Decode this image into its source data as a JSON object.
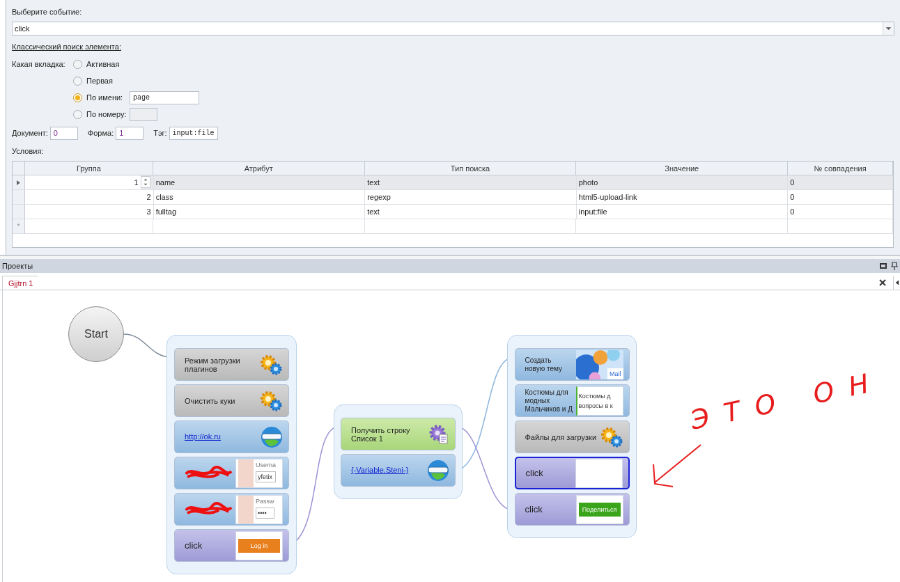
{
  "event": {
    "label": "Выберите событие:",
    "value": "click"
  },
  "search_heading": "Классический поиск элемента:",
  "tab_choice": {
    "label": "Какая вкладка:",
    "options": [
      {
        "label": "Активная",
        "selected": false,
        "kind": "plain"
      },
      {
        "label": "Первая",
        "selected": false,
        "kind": "plain"
      },
      {
        "label": "По имени:",
        "selected": true,
        "kind": "text",
        "value": "page"
      },
      {
        "label": "По номеру:",
        "selected": false,
        "kind": "disabled"
      }
    ]
  },
  "fields": [
    {
      "label": "Документ:",
      "value": "0",
      "kind": "short"
    },
    {
      "label": "Форма:",
      "value": "1",
      "kind": "short"
    },
    {
      "label": "Тэг:",
      "value": "input:file",
      "kind": "mono"
    }
  ],
  "conditions": {
    "label": "Условия:",
    "columns": [
      "Группа",
      "Атрибут",
      "Тип поиска",
      "Значение",
      "№ совпадения"
    ],
    "rows": [
      {
        "cells": [
          "1",
          "name",
          "text",
          "photo",
          "0"
        ],
        "selected": true
      },
      {
        "cells": [
          "2",
          "class",
          "regexp",
          "html5-upload-link",
          "0"
        ],
        "selected": false
      },
      {
        "cells": [
          "3",
          "fulltag",
          "text",
          "input:file",
          "0"
        ],
        "selected": false
      }
    ],
    "new_row_marker": "*"
  },
  "projects": {
    "title": "Проекты",
    "tab": "Gjjtrn 1"
  },
  "diagram": {
    "start": "Start",
    "groups": [
      {
        "nodes": [
          {
            "kind": "gear",
            "label": "Режим загрузки плагинов",
            "selected": false,
            "redacted": false
          },
          {
            "kind": "gear",
            "label": "Очистить куки",
            "selected": false,
            "redacted": false
          },
          {
            "kind": "navigate",
            "label": "http://ok.ru",
            "selected": false,
            "redacted": false
          },
          {
            "kind": "input",
            "selected": false,
            "redacted": true,
            "thumb": {
              "kind": "field",
              "label": "Userna",
              "value": "yfetix"
            }
          },
          {
            "kind": "input",
            "selected": false,
            "redacted": true,
            "thumb": {
              "kind": "field",
              "label": "Passw",
              "value": "••••"
            }
          },
          {
            "kind": "click",
            "label": "click",
            "selected": false,
            "redacted": false,
            "thumb": {
              "kind": "button",
              "text": "Log in",
              "color": "#e8801e"
            }
          }
        ]
      },
      {
        "nodes": [
          {
            "kind": "list",
            "label": "Получить строку Список 1",
            "selected": false,
            "redacted": false
          },
          {
            "kind": "navigate",
            "label": "{-Variable.Steni-}",
            "selected": false,
            "redacted": false
          }
        ]
      },
      {
        "nodes": [
          {
            "kind": "input",
            "label": "Создать новую тему",
            "selected": false,
            "redacted": false,
            "thumb": {
              "kind": "image",
              "text": "Mail"
            }
          },
          {
            "kind": "input",
            "label": "Костюмы для модных Мальчиков  и Д",
            "selected": false,
            "redacted": false,
            "thumb": {
              "kind": "text",
              "lines": [
                "Костюмы д",
                "вопросы в к"
              ]
            }
          },
          {
            "kind": "gear",
            "label": "Файлы для загрузки",
            "selected": false,
            "redacted": false
          },
          {
            "kind": "click",
            "label": "click",
            "selected": true,
            "redacted": false,
            "thumb": {
              "kind": "blank"
            }
          },
          {
            "kind": "click",
            "label": "click",
            "selected": false,
            "redacted": false,
            "thumb": {
              "kind": "button",
              "text": "Поделиться",
              "color": "#3aa41a"
            }
          }
        ]
      }
    ]
  },
  "annotation": "ЭТО ОН"
}
